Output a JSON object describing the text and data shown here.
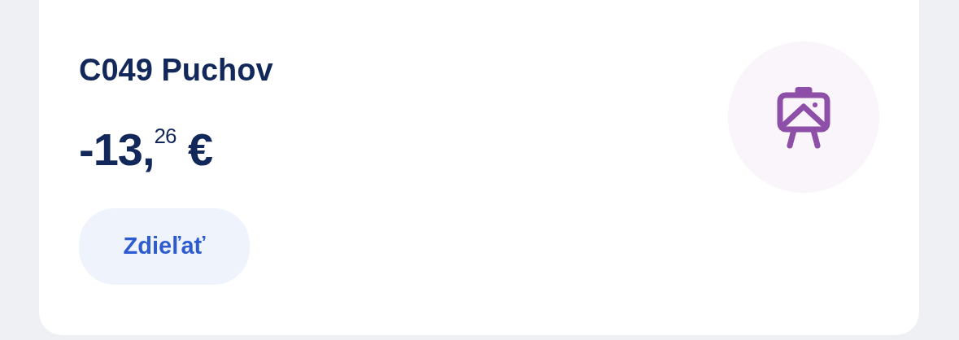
{
  "card": {
    "title": "C049 Puchov",
    "amount": "-13,$^{26}$ €",
    "share_button": "Zdieľať"
  }
}
